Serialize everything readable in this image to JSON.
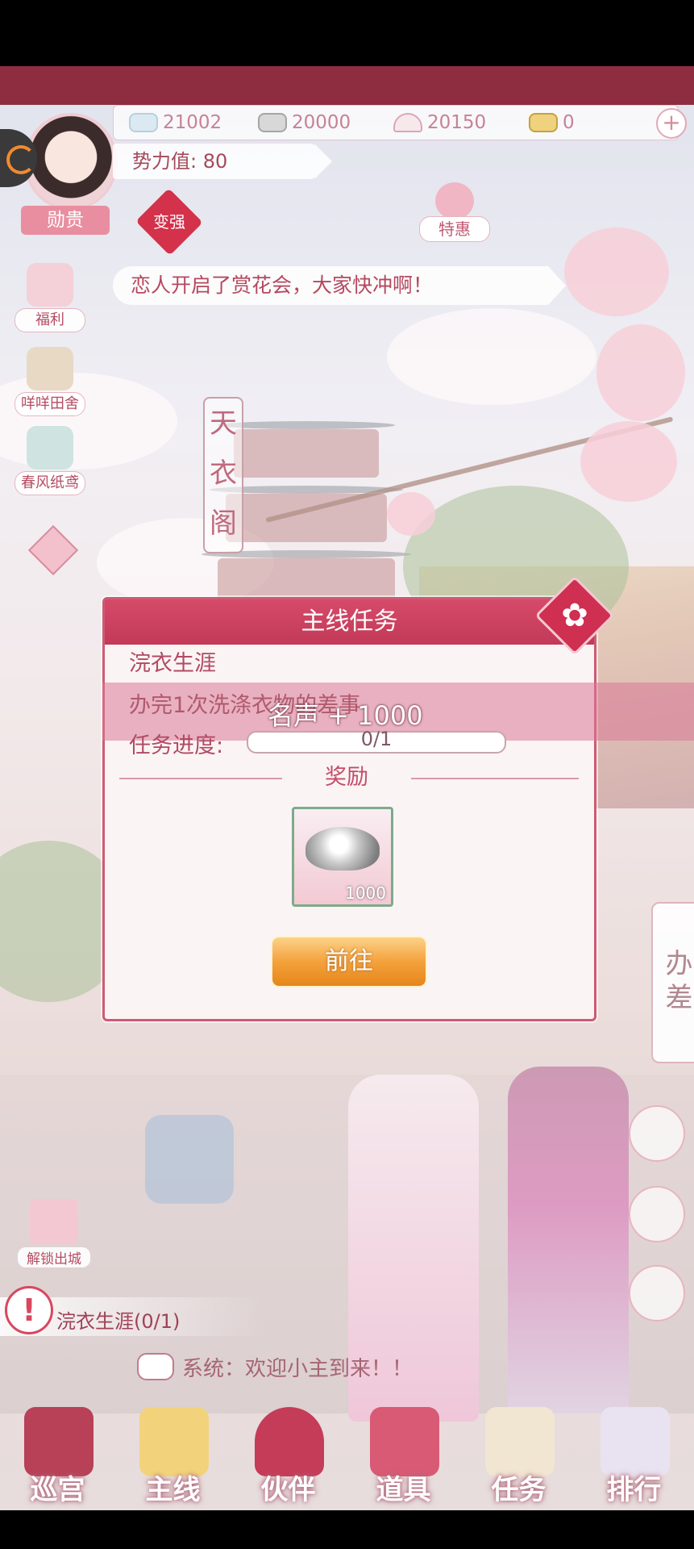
{
  "resources": [
    {
      "icon": "jade-icon",
      "value": "21002"
    },
    {
      "icon": "silver-ingot-icon",
      "value": "20000"
    },
    {
      "icon": "fan-icon",
      "value": "20150"
    },
    {
      "icon": "gold-ingot-icon",
      "value": "0"
    }
  ],
  "player": {
    "power_label": "势力值: 80",
    "rank": "勋贵"
  },
  "tags": {
    "bianqiang": "变强",
    "tehui": "特惠"
  },
  "announcement": "恋人开启了赏花会，大家快冲啊！",
  "side_menu": [
    {
      "label": "福利",
      "icon": "gift-icon"
    },
    {
      "label": "咩咩田舍",
      "icon": "farm-icon"
    },
    {
      "label": "春风纸鸢",
      "icon": "kite-icon"
    }
  ],
  "scene_sign": "天衣阁",
  "right_panel": {
    "banchai": "办差"
  },
  "unlock_label": "解锁出城",
  "quest_tracker": "浣衣生涯(0/1)",
  "system_message": "系统：欢迎小主到来！！",
  "bottom_nav": [
    {
      "label": "巡宫",
      "icon": "palace-gate-icon"
    },
    {
      "label": "主线",
      "icon": "scroll-icon"
    },
    {
      "label": "伙伴",
      "icon": "companion-hat-icon"
    },
    {
      "label": "道具",
      "icon": "chest-icon"
    },
    {
      "label": "任务",
      "icon": "task-book-icon"
    },
    {
      "label": "排行",
      "icon": "ranking-icon"
    }
  ],
  "dialog": {
    "title": "主线任务",
    "task_name": "浣衣生涯",
    "task_desc": "办完1次洗涤衣物的差事",
    "progress_label": "任务进度:",
    "progress_text": "0/1",
    "progress_fraction": 0,
    "reward_title": "奖励",
    "reward_item": {
      "icon": "silver-ingot-icon",
      "count": "1000"
    },
    "go_button": "前往",
    "floating_reward": "名声 + 1000"
  },
  "colors": {
    "accent": "#cf2f50",
    "frame": "#8e2d3f",
    "button_orange": "#f4a23c"
  }
}
